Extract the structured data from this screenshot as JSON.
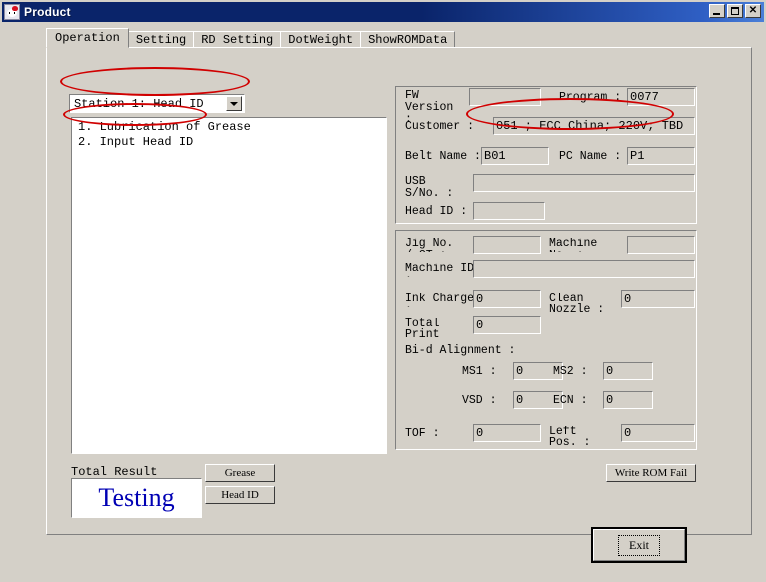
{
  "window": {
    "title": "Product",
    "icon": "app-icon",
    "buttons": {
      "minimize": "_",
      "maximize": "□",
      "close": "✕"
    }
  },
  "tabs": [
    {
      "label": "Operation",
      "active": true
    },
    {
      "label": "Setting",
      "active": false
    },
    {
      "label": "RD Setting",
      "active": false
    },
    {
      "label": "DotWeight",
      "active": false
    },
    {
      "label": "ShowROMData",
      "active": false
    }
  ],
  "station": {
    "selected": "Station 1: Head ID",
    "steps": [
      "1. Lubrication of Grease",
      "2. Input Head ID"
    ]
  },
  "result": {
    "label": "Total Result",
    "value": "Testing",
    "color": "#0000b4"
  },
  "buttons": {
    "grease": "Grease",
    "head_id": "Head ID",
    "write_rom_fail": "Write ROM Fail",
    "exit": "Exit"
  },
  "info": {
    "fw_version": {
      "label": "FW Version :",
      "value": ""
    },
    "program": {
      "label": "Program :",
      "value": "0077"
    },
    "customer": {
      "label": "Customer :",
      "value": "051 ; ECC China; 220V; TBD"
    },
    "belt_name": {
      "label": "Belt Name :",
      "value": "B01"
    },
    "pc_name": {
      "label": "PC Name :",
      "value": "P1"
    },
    "usb_sno": {
      "label": "USB S/No. :",
      "value": ""
    },
    "head_id": {
      "label": "Head ID :",
      "value": ""
    }
  },
  "machine": {
    "jig_no": {
      "label": "Jig No. / CT :",
      "value": ""
    },
    "machine_no": {
      "label": "Machine No. :",
      "value": ""
    },
    "machine_id": {
      "label": "Machine ID :",
      "value": ""
    },
    "ink_charge": {
      "label": "Ink Charge :",
      "value": "0"
    },
    "clean_nozzle": {
      "label": "Clean Nozzle :",
      "value": "0"
    },
    "total_print": {
      "label": "Total Print :",
      "value": "0"
    },
    "bid_alignment_label": "Bi-d Alignment :",
    "ms1": {
      "label": "MS1 :",
      "value": "0"
    },
    "ms2": {
      "label": "MS2 :",
      "value": "0"
    },
    "vsd": {
      "label": "VSD :",
      "value": "0"
    },
    "ecn": {
      "label": "ECN :",
      "value": "0"
    },
    "tof": {
      "label": "TOF :",
      "value": "0"
    },
    "left_pos": {
      "label": "Left Pos. :",
      "value": "0"
    }
  },
  "annotations": {
    "color": "#d00000",
    "items": [
      "station-combo-highlight",
      "input-head-id-highlight",
      "customer-value-highlight"
    ]
  }
}
